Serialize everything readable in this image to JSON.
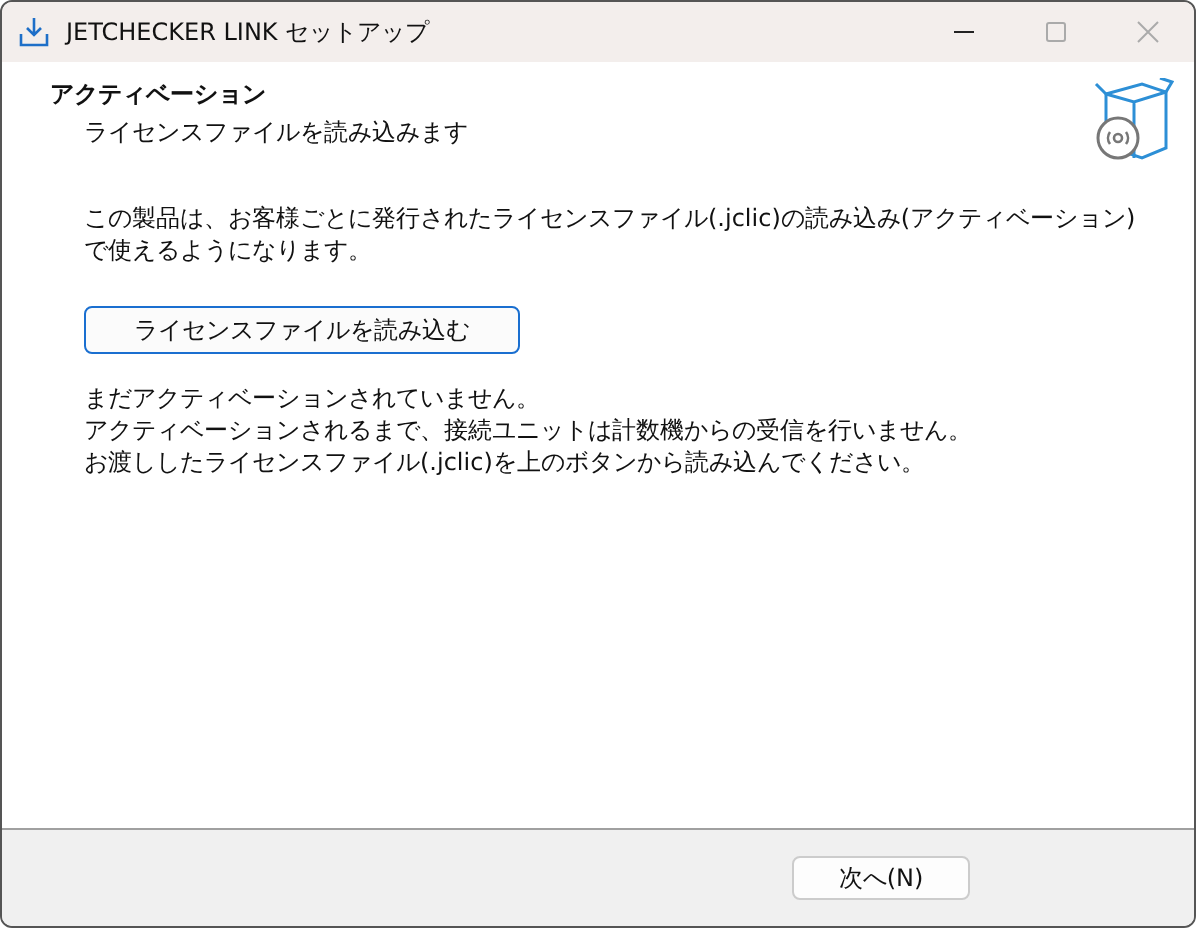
{
  "window": {
    "title": "JETCHECKER LINK セットアップ"
  },
  "header": {
    "title": "アクティベーション",
    "subtitle": "ライセンスファイルを読み込みます"
  },
  "description": "この製品は、お客様ごとに発行されたライセンスファイル(.jclic)の読み込み(アクティベーション)で使えるようになります。",
  "load_button": {
    "label": "ライセンスファイルを読み込む"
  },
  "status_lines": [
    "まだアクティベーションされていません。",
    "アクティベーションされるまで、接続ユニットは計数機からの受信を行いません。",
    "お渡ししたライセンスファイル(.jclic)を上のボタンから読み込んでください。"
  ],
  "footer": {
    "buttons": [
      {
        "label": "次へ(N)"
      }
    ]
  }
}
